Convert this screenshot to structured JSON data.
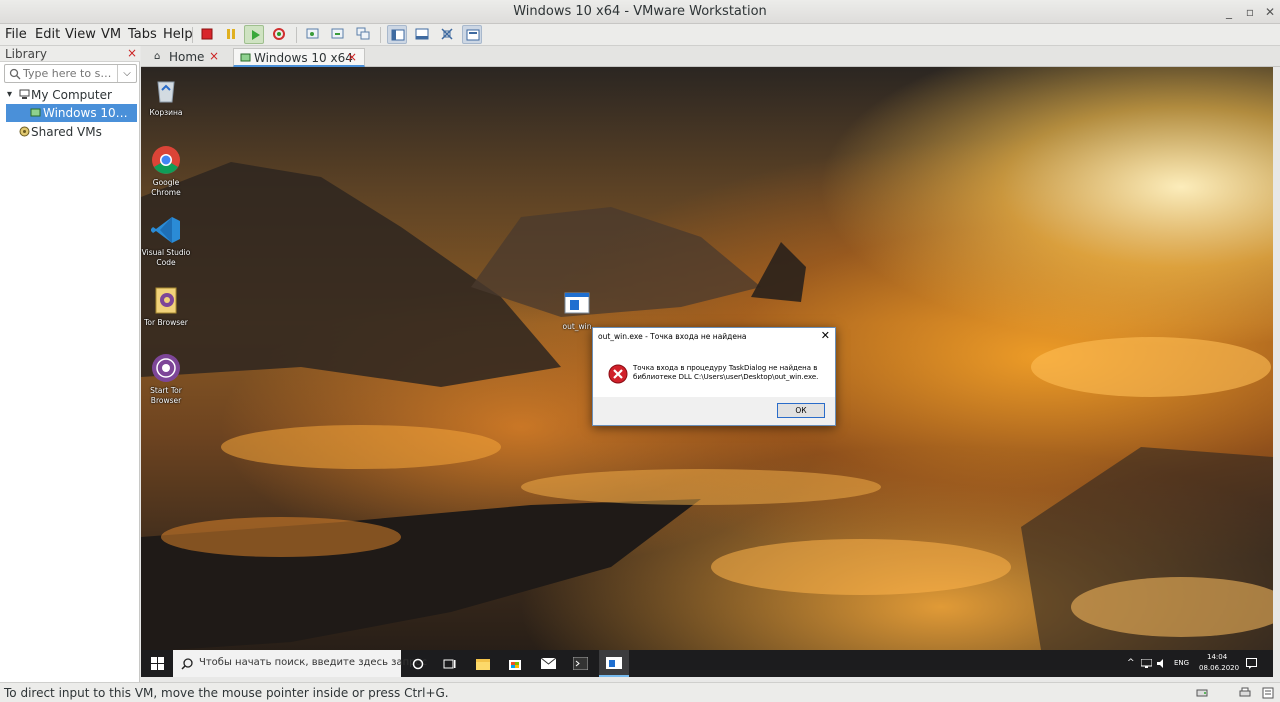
{
  "window": {
    "title": "Windows 10 x64 - VMware Workstation"
  },
  "menu": [
    "File",
    "Edit",
    "View",
    "VM",
    "Tabs",
    "Help"
  ],
  "library": {
    "title": "Library",
    "search_placeholder": "Type here to s…",
    "tree": [
      {
        "label": "My Computer",
        "expanded": true
      },
      {
        "label": "Windows 10…",
        "selected": true
      },
      {
        "label": "Shared VMs"
      }
    ]
  },
  "tabs": [
    {
      "label": "Home",
      "icon": "home-icon"
    },
    {
      "label": "Windows 10 x64",
      "icon": "vm-icon",
      "active": true
    }
  ],
  "desktop": {
    "icons": [
      {
        "name": "Корзина",
        "icon": "recycle-bin-icon"
      },
      {
        "name": "Google Chrome",
        "icon": "chrome-icon"
      },
      {
        "name": "Visual Studio Code",
        "icon": "vscode-icon"
      },
      {
        "name": "Tor Browser",
        "icon": "tor-folder-icon"
      },
      {
        "name": "Start Tor Browser",
        "icon": "tor-icon"
      },
      {
        "name": "out_win",
        "icon": "exe-icon"
      }
    ]
  },
  "dialog": {
    "title": "out_win.exe - Точка входа не найдена",
    "message": "Точка входа в процедуру TaskDialog не найдена в библиотеке DLL C:\\Users\\user\\Desktop\\out_win.exe.",
    "ok_label": "ОК"
  },
  "taskbar": {
    "search_placeholder": "Чтобы начать поиск, введите здесь запрос",
    "lang": "ENG",
    "time": "14:04",
    "date": "08.06.2020"
  },
  "statusbar": {
    "text": "To direct input to this VM, move the mouse pointer inside or press Ctrl+G."
  },
  "colors": {
    "selection": "#4a90d9",
    "accent": "#2a6cc9",
    "error": "#d0202a"
  }
}
